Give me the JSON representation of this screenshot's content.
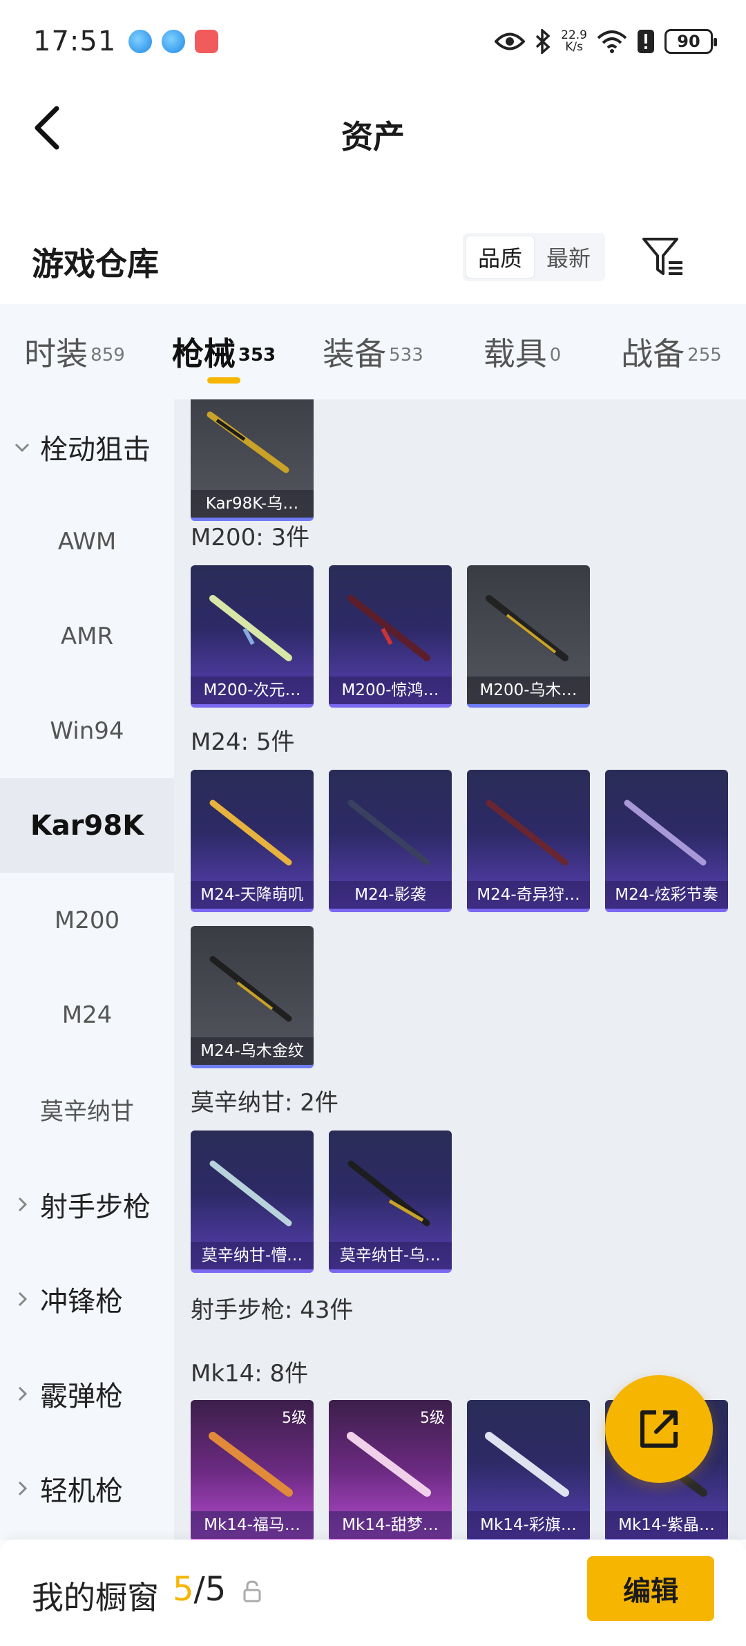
{
  "status_bar": {
    "time": "17:51",
    "net_speed_value": "22.9",
    "net_speed_unit": "K/s",
    "battery": "90"
  },
  "header": {
    "title": "资产"
  },
  "warehouse": {
    "title": "游戏仓库",
    "sort_options": [
      "品质",
      "最新"
    ],
    "active_sort": "品质"
  },
  "tabs": [
    {
      "label": "时装",
      "count": "859"
    },
    {
      "label": "枪械",
      "count": "353",
      "active": true
    },
    {
      "label": "装备",
      "count": "533"
    },
    {
      "label": "载具",
      "count": "0"
    },
    {
      "label": "战备",
      "count": "255"
    }
  ],
  "sidenav": [
    {
      "label": "栓动狙击",
      "type": "group-expanded"
    },
    {
      "label": "AWM",
      "type": "item"
    },
    {
      "label": "AMR",
      "type": "item"
    },
    {
      "label": "Win94",
      "type": "item"
    },
    {
      "label": "Kar98K",
      "type": "item-active"
    },
    {
      "label": "M200",
      "type": "item"
    },
    {
      "label": "M24",
      "type": "item"
    },
    {
      "label": "莫辛纳甘",
      "type": "item"
    },
    {
      "label": "射手步枪",
      "type": "group-collapsed"
    },
    {
      "label": "冲锋枪",
      "type": "group-collapsed"
    },
    {
      "label": "霰弹枪",
      "type": "group-collapsed"
    },
    {
      "label": "轻机枪",
      "type": "group-collapsed"
    }
  ],
  "content": {
    "sections": [
      {
        "label": "M200: 3件"
      },
      {
        "label": "M24: 5件"
      },
      {
        "label": "莫辛纳甘: 2件"
      },
      {
        "label": "射手步枪: 43件"
      },
      {
        "label": "Mk14: 8件"
      }
    ],
    "cards": [
      {
        "name": "Kar98K-乌…",
        "style": "grey"
      },
      {
        "name": "M200-次元…",
        "style": "purple"
      },
      {
        "name": "M200-惊鸿…",
        "style": "purple"
      },
      {
        "name": "M200-乌木…",
        "style": "grey"
      },
      {
        "name": "M24-天降萌叽",
        "style": "purple"
      },
      {
        "name": "M24-影袭",
        "style": "purple"
      },
      {
        "name": "M24-奇异狩…",
        "style": "purple"
      },
      {
        "name": "M24-炫彩节奏",
        "style": "purple"
      },
      {
        "name": "M24-乌木金纹",
        "style": "grey"
      },
      {
        "name": "莫辛纳甘-懵…",
        "style": "purple"
      },
      {
        "name": "莫辛纳甘-乌…",
        "style": "purple"
      },
      {
        "name": "Mk14-福马…",
        "style": "pink",
        "tier": "5级"
      },
      {
        "name": "Mk14-甜梦…",
        "style": "pink",
        "tier": "5级"
      },
      {
        "name": "Mk14-彩旗…",
        "style": "purple"
      },
      {
        "name": "Mk14-紫晶…",
        "style": "purple"
      }
    ]
  },
  "bottom_bar": {
    "label": "我的橱窗",
    "current": "5",
    "separator": "/",
    "max": "5",
    "edit_label": "编辑"
  },
  "colors": {
    "accent": "#f6b500",
    "tab_bg": "#f4f7fb",
    "content_bg": "#ebeef3"
  },
  "icons": [
    "back-arrow-icon",
    "filter-icon",
    "share-icon",
    "lock-icon",
    "eye-icon",
    "bluetooth-icon",
    "wifi-icon"
  ]
}
